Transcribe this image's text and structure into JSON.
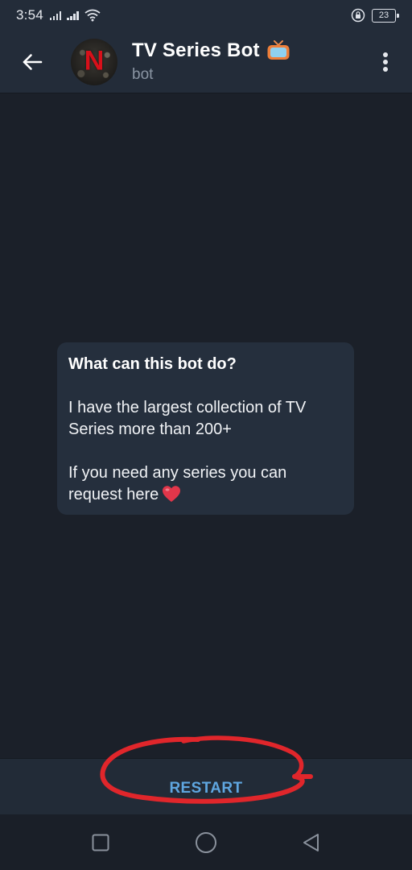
{
  "status_bar": {
    "time": "3:54",
    "battery": "23"
  },
  "header": {
    "title": "TV Series Bot",
    "subtitle": "bot",
    "avatar_letter": "N"
  },
  "message": {
    "heading": "What can this bot do?",
    "line1": "I have the largest collection of TV Series more than 200+",
    "line2": "If you need any series you can request here"
  },
  "restart_bar": {
    "label": "RESTART"
  },
  "colors": {
    "background": "#1b2029",
    "header": "#232c39",
    "bubble": "#252f3d",
    "accent": "#5fa6e0",
    "annotation": "#e0262b"
  },
  "icons": {
    "back": "arrow-left-icon",
    "tv_emoji": "tv-icon",
    "more": "more-vertical-icon",
    "heart": "heart-icon",
    "nav_recents": "square-icon",
    "nav_home": "circle-icon",
    "nav_back": "triangle-back-icon"
  }
}
